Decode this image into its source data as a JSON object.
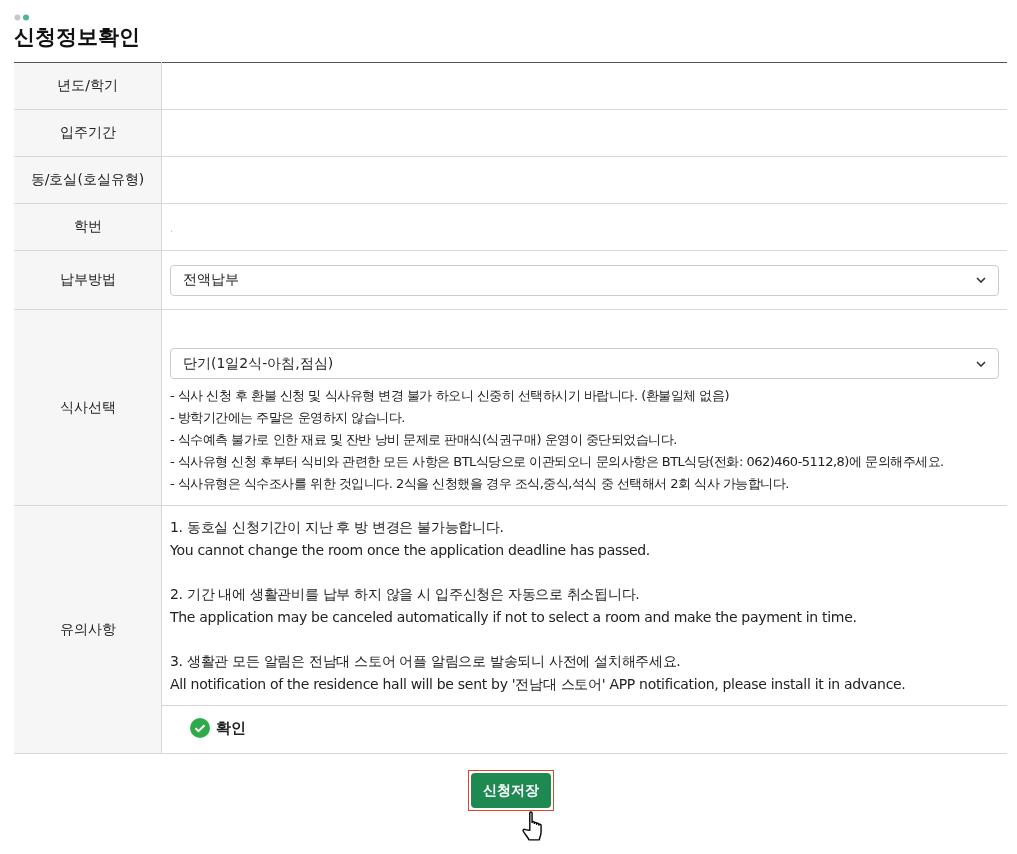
{
  "page_title": "신청정보확인",
  "rows": [
    {
      "label": "년도/학기",
      "kind": "text",
      "value": ""
    },
    {
      "label": "입주기간",
      "kind": "text",
      "value": ""
    },
    {
      "label": "동/호실(호실유형)",
      "kind": "text",
      "value": ""
    },
    {
      "label": "학번",
      "kind": "text",
      "value": "."
    },
    {
      "label": "납부방법",
      "kind": "select",
      "value": "전액납부"
    },
    {
      "label": "식사선택",
      "kind": "select_notes",
      "value": "단기(1일2식-아침,점심)",
      "notes": [
        "- 식사 신청 후 환불 신청 및 식사유형 변경 불가 하오니 신중히 선택하시기 바랍니다. (환불일체 없음)",
        "- 방학기간에는 주말은 운영하지 않습니다.",
        "- 식수예측 불가로 인한 재료 및 잔반 낭비 문제로 판매식(식권구매) 운영이 중단되었습니다.",
        "- 식사유형 신청 후부터 식비와 관련한 모든 사항은 BTL식당으로 이관되오니 문의사항은 BTL식당(전화: 062)460-5112,8)에 문의해주세요.",
        "- 식사유형은 식수조사를 위한 것입니다. 2식을 신청했을 경우 조식,중식,석식 중 선택해서 2회 식사 가능합니다."
      ]
    },
    {
      "label": "유의사항",
      "kind": "notice",
      "paragraphs": [
        [
          "1. 동호실 신청기간이 지난 후 방 변경은 불가능합니다.",
          "You cannot change the room once the application deadline has passed."
        ],
        [
          "2. 기간 내에 생활관비를 납부 하지 않을 시 입주신청은 자동으로 취소됩니다.",
          "The application may be canceled automatically if not to select a room and make the payment in time."
        ],
        [
          "3. 생활관 모든 알림은 전남대 스토어 어플 알림으로 발송되니 사전에 설치해주세요.",
          "All notification of the residence hall will be sent by '전남대 스토어' APP notification, please install it in advance."
        ]
      ],
      "confirm": {
        "label": "확인",
        "checked": true
      }
    }
  ],
  "save_button": {
    "label": "신청저장"
  }
}
